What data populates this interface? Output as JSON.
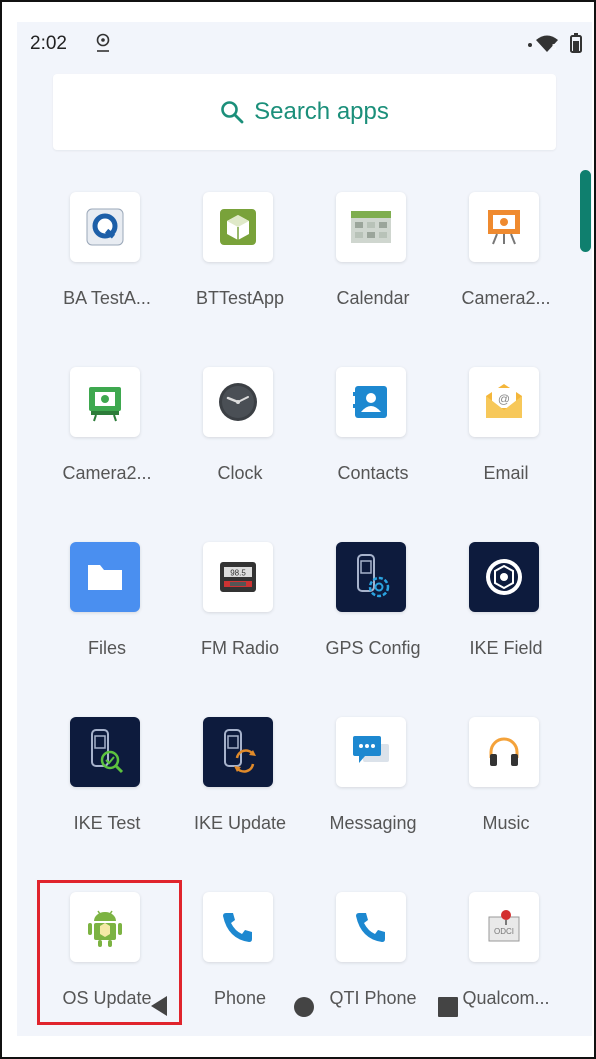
{
  "status": {
    "time": "2:02"
  },
  "search": {
    "label": "Search apps"
  },
  "apps": [
    {
      "label": "BA TestA...",
      "icon": "ba-test-icon"
    },
    {
      "label": "BTTestApp",
      "icon": "bt-test-icon"
    },
    {
      "label": "Calendar",
      "icon": "calendar-icon"
    },
    {
      "label": "Camera2...",
      "icon": "camera2-icon"
    },
    {
      "label": "Camera2...",
      "icon": "camera2-green-icon"
    },
    {
      "label": "Clock",
      "icon": "clock-icon"
    },
    {
      "label": "Contacts",
      "icon": "contacts-icon"
    },
    {
      "label": "Email",
      "icon": "email-icon"
    },
    {
      "label": "Files",
      "icon": "files-icon"
    },
    {
      "label": "FM Radio",
      "icon": "fm-radio-icon"
    },
    {
      "label": "GPS Config",
      "icon": "gps-config-icon"
    },
    {
      "label": "IKE Field",
      "icon": "ike-field-icon"
    },
    {
      "label": "IKE Test",
      "icon": "ike-test-icon"
    },
    {
      "label": "IKE Update",
      "icon": "ike-update-icon"
    },
    {
      "label": "Messaging",
      "icon": "messaging-icon"
    },
    {
      "label": "Music",
      "icon": "music-icon"
    },
    {
      "label": "OS Update",
      "icon": "os-update-icon"
    },
    {
      "label": "Phone",
      "icon": "phone-icon"
    },
    {
      "label": "QTI Phone",
      "icon": "qti-phone-icon"
    },
    {
      "label": "Qualcom...",
      "icon": "qualcomm-icon"
    }
  ],
  "colors": {
    "accent": "#1b8f7a",
    "highlight": "#e0242c"
  }
}
